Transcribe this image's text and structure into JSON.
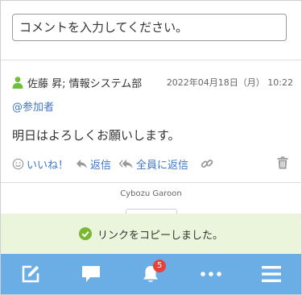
{
  "comment_input": {
    "placeholder": "コメントを入力してください。"
  },
  "comment": {
    "author": "佐藤 昇; 情報システム部",
    "timestamp": "2022年04月18日（月） 10:22",
    "mention": "@参加者",
    "body": "明日はよろしくお願いします。",
    "actions": {
      "like_label": "いいね！",
      "reply_label": "返信",
      "reply_all_label": "全員に返信"
    }
  },
  "footer": {
    "brand": "Cybozu Garoon"
  },
  "toast": {
    "message": "リンクをコピーしました。"
  },
  "bottom_nav": {
    "notification_count": "5"
  },
  "colors": {
    "accent": "#3c78c8",
    "user_icon": "#6fbf3a",
    "toast_bg": "#eaf5dc",
    "toast_check": "#79b833",
    "nav_bg": "#6aaee5",
    "badge": "#e8413c"
  },
  "icons": [
    "user-icon",
    "smile-icon",
    "reply-icon",
    "reply-all-icon",
    "link-icon",
    "trash-icon",
    "check-circle-icon",
    "compose-icon",
    "message-icon",
    "bell-icon",
    "more-icon",
    "menu-icon"
  ]
}
